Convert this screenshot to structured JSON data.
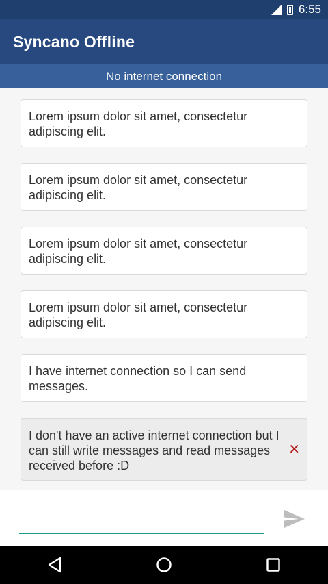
{
  "status_bar": {
    "time": "6:55",
    "icons": [
      "signal-icon",
      "battery-icon"
    ]
  },
  "app_bar": {
    "title": "Syncano Offline"
  },
  "banner": {
    "text": "No internet connection"
  },
  "messages": [
    {
      "text": "Lorem ipsum dolor sit amet, consectetur adipiscing elit.",
      "state": "sent"
    },
    {
      "text": "Lorem ipsum dolor sit amet, consectetur adipiscing elit.",
      "state": "sent"
    },
    {
      "text": "Lorem ipsum dolor sit amet, consectetur adipiscing elit.",
      "state": "sent"
    },
    {
      "text": "Lorem ipsum dolor sit amet, consectetur adipiscing elit.",
      "state": "sent"
    },
    {
      "text": "I have internet connection so I can send messages.",
      "state": "sent"
    },
    {
      "text": "I don't have an active internet connection but I can still write messages and read messages received before :D",
      "state": "pending",
      "error_icon": "✕"
    }
  ],
  "composer": {
    "value": "",
    "placeholder": "",
    "send_icon": "send-icon"
  },
  "nav_bar": {
    "icons": [
      "back-icon",
      "home-icon",
      "recents-icon"
    ]
  },
  "colors": {
    "status_bar": "#1f3f6f",
    "app_bar": "#27497f",
    "banner": "#38609a",
    "accent": "#179a89",
    "error": "#b71c1c"
  }
}
